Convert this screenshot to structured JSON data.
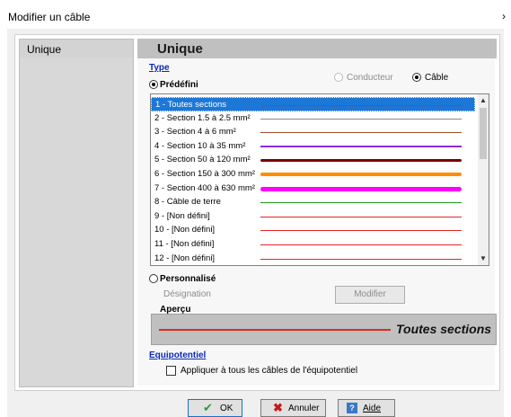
{
  "window": {
    "title": "Modifier un câble",
    "close_glyph": "›"
  },
  "sidebar": {
    "items": [
      {
        "label": "Unique",
        "selected": true
      }
    ]
  },
  "header": {
    "title": "Unique"
  },
  "type_section": {
    "heading": "Type",
    "predefini_label": "Prédéfini",
    "predefini_checked": true,
    "conducteur_label": "Conducteur",
    "conducteur_enabled": false,
    "cable_label": "Câble",
    "cable_checked": true
  },
  "cable_list": {
    "items": [
      {
        "label": "1 - Toutes sections",
        "color": "#e82424",
        "thickness": 1,
        "selected": true
      },
      {
        "label": "2 - Section 1.5 à 2.5 mm²",
        "color": "#8a8a8a",
        "thickness": 1
      },
      {
        "label": "3 - Section 4 à 6 mm²",
        "color": "#a0522d",
        "thickness": 1
      },
      {
        "label": "4 - Section 10 à 35 mm²",
        "color": "#8a2be2",
        "thickness": 2
      },
      {
        "label": "5 - Section 50 à 120 mm²",
        "color": "#7a0000",
        "thickness": 3
      },
      {
        "label": "6 - Section 150 à 300 mm²",
        "color": "#ff8c00",
        "thickness": 4
      },
      {
        "label": "7 - Section 400 à 630 mm²",
        "color": "#ff00ff",
        "thickness": 5
      },
      {
        "label": "8 - Câble de terre",
        "color": "#1b9a1b",
        "thickness": 1
      },
      {
        "label": "9 - [Non défini]",
        "color": "#e82424",
        "thickness": 1
      },
      {
        "label": "10 - [Non défini]",
        "color": "#e82424",
        "thickness": 1
      },
      {
        "label": "11 - [Non défini]",
        "color": "#e82424",
        "thickness": 1
      },
      {
        "label": "12 - [Non défini]",
        "color": "#e82424",
        "thickness": 1
      }
    ],
    "scroll_up_glyph": "▲",
    "scroll_down_glyph": "▼"
  },
  "personnalise": {
    "label": "Personnalisé",
    "checked": false,
    "designation_label": "Désignation",
    "modifier_label": "Modifier"
  },
  "apercu": {
    "label": "Aperçu",
    "text": "Toutes sections",
    "line_color": "#e82424"
  },
  "equipotentiel": {
    "heading": "Equipotentiel",
    "checkbox_label": "Appliquer à tous les câbles de l'équipotentiel",
    "checked": false
  },
  "footer": {
    "ok_label": "OK",
    "annuler_label": "Annuler",
    "aide_label": "Aide",
    "ok_icon": "checkmark-icon",
    "annuler_icon": "cross-icon",
    "aide_icon": "help-icon"
  }
}
